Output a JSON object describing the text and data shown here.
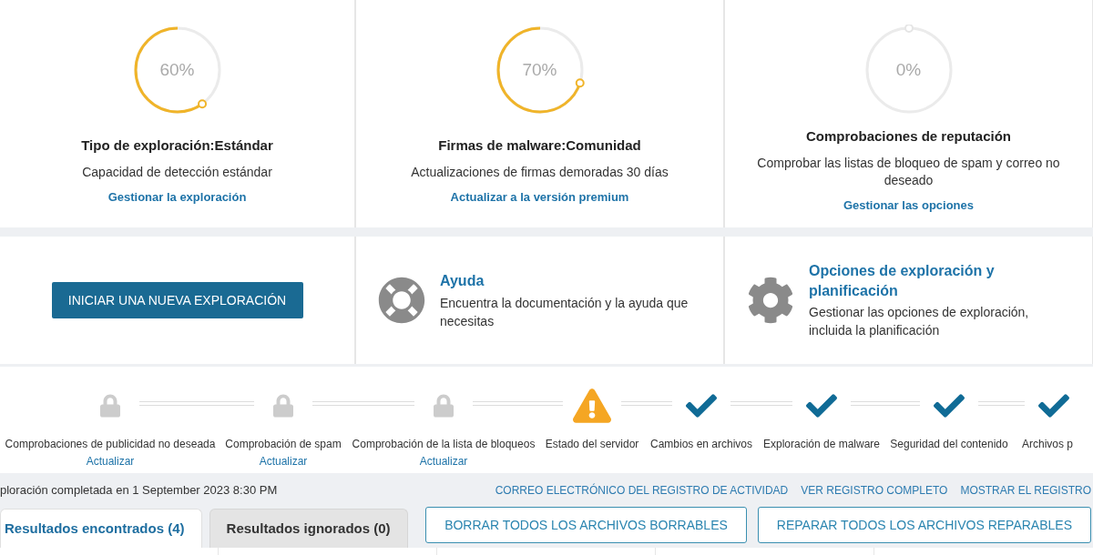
{
  "summary_cards": [
    {
      "percent": "60%",
      "title": "Tipo de exploración:Estándar",
      "description": "Capacidad de detección estándar",
      "link": "Gestionar la exploración"
    },
    {
      "percent": "70%",
      "title": "Firmas de malware:Comunidad",
      "description": "Actualizaciones de firmas demoradas 30 días",
      "link": "Actualizar a la versión premium"
    },
    {
      "percent": "0%",
      "title": "Comprobaciones de reputación",
      "description": "Comprobar las listas de bloqueo de spam y correo no deseado",
      "link": "Gestionar las opciones"
    }
  ],
  "start_button": "INICIAR UNA NUEVA EXPLORACIÓN",
  "help": {
    "title": "Ayuda",
    "description": "Encuentra la documentación y la ayuda que necesitas"
  },
  "scan_options": {
    "title": "Opciones de exploración y planificación",
    "description": "Gestionar las opciones de exploración, incluida la planificación"
  },
  "steps": [
    {
      "kind": "locked",
      "label": "Comprobaciones de publicidad no deseada",
      "link": "Actualizar"
    },
    {
      "kind": "locked",
      "label": "Comprobación de spam",
      "link": "Actualizar"
    },
    {
      "kind": "locked",
      "label": "Comprobación de la lista de bloqueos",
      "link": "Actualizar"
    },
    {
      "kind": "warning",
      "label": "Estado del servidor"
    },
    {
      "kind": "done",
      "label": "Cambios en archivos"
    },
    {
      "kind": "done",
      "label": "Exploración de malware"
    },
    {
      "kind": "done",
      "label": "Seguridad del contenido"
    },
    {
      "kind": "done",
      "label": "Archivos p"
    }
  ],
  "status": "ploración completada en 1 September 2023 8:30 PM",
  "log_links": [
    "CORREO ELECTRÓNICO DEL REGISTRO DE ACTIVIDAD",
    "VER REGISTRO COMPLETO",
    "MOSTRAR EL REGISTRO"
  ],
  "tabs": [
    {
      "label": "Resultados encontrados (4)",
      "selected": true
    },
    {
      "label": "Resultados ignorados (0)",
      "selected": false
    }
  ],
  "actions": [
    "BORRAR TODOS LOS ARCHIVOS BORRABLES",
    "REPARAR TODOS LOS ARCHIVOS REPARABLES"
  ]
}
